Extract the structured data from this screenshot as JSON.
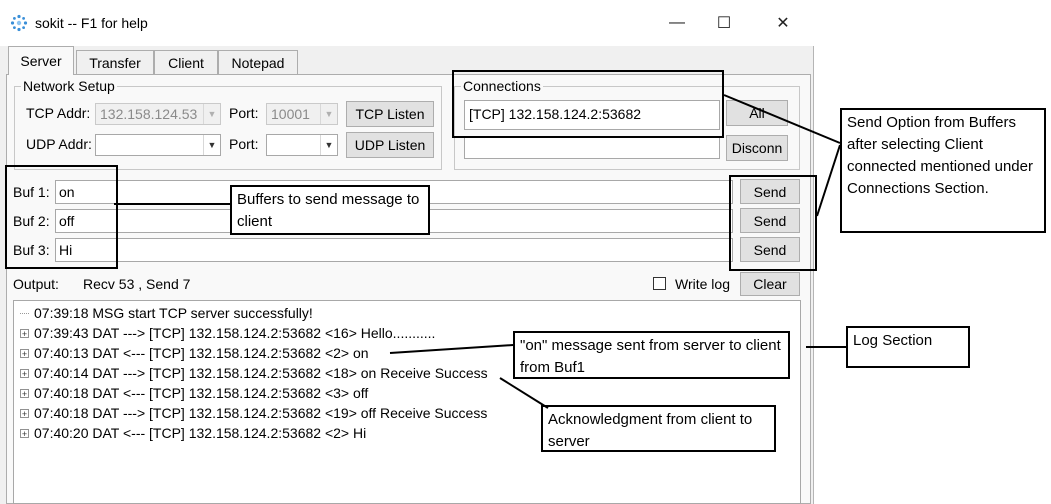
{
  "window": {
    "title": "sokit -- F1 for help",
    "controls": {
      "minimize": "—",
      "maximize": "☐",
      "close": "✕"
    },
    "icon": "sokit-app-icon"
  },
  "tabs": [
    "Server",
    "Transfer",
    "Client",
    "Notepad"
  ],
  "network_setup": {
    "legend": "Network Setup",
    "tcp_addr_label": "TCP Addr:",
    "tcp_addr_value": "132.158.124.53",
    "tcp_port_label": "Port:",
    "tcp_port_value": "10001",
    "tcp_listen_label": "TCP Listen",
    "udp_addr_label": "UDP Addr:",
    "udp_addr_value": "",
    "udp_port_label": "Port:",
    "udp_port_value": "",
    "udp_listen_label": "UDP Listen"
  },
  "connections": {
    "legend": "Connections",
    "items": [
      "[TCP] 132.158.124.2:53682"
    ],
    "all_label": "All",
    "disconnect_label": "Disconn"
  },
  "buffers": [
    {
      "label": "Buf 1:",
      "value": "on",
      "send_label": "Send"
    },
    {
      "label": "Buf 2:",
      "value": "off",
      "send_label": "Send"
    },
    {
      "label": "Buf 3:",
      "value": "Hi",
      "send_label": "Send"
    }
  ],
  "output": {
    "label": "Output:",
    "stats": "Recv 53 , Send 7",
    "write_log_label": "Write log",
    "write_log_checked": false,
    "clear_label": "Clear"
  },
  "log": [
    {
      "text": "07:39:18 MSG start TCP server successfully!",
      "expandable": false
    },
    {
      "text": "07:39:43 DAT ---> [TCP] 132.158.124.2:53682 <16> Hello...........",
      "expandable": true
    },
    {
      "text": "07:40:13 DAT <--- [TCP] 132.158.124.2:53682 <2> on",
      "expandable": true
    },
    {
      "text": "07:40:14 DAT ---> [TCP] 132.158.124.2:53682 <18> on Receive Success",
      "expandable": true
    },
    {
      "text": "07:40:18 DAT <--- [TCP] 132.158.124.2:53682 <3> off",
      "expandable": true
    },
    {
      "text": "07:40:18 DAT ---> [TCP] 132.158.124.2:53682 <19> off Receive Success",
      "expandable": true
    },
    {
      "text": "07:40:20 DAT <--- [TCP] 132.158.124.2:53682 <2> Hi",
      "expandable": true
    }
  ],
  "annotations": {
    "send_option": "Send Option from Buffers after selecting Client connected mentioned under Connections Section.",
    "buffers": "Buffers to send message to client",
    "log_section": "Log Section",
    "on_message": "\"on\" message sent from server to client from Buf1",
    "acknowledgment": "Acknowledgment from client to server"
  }
}
